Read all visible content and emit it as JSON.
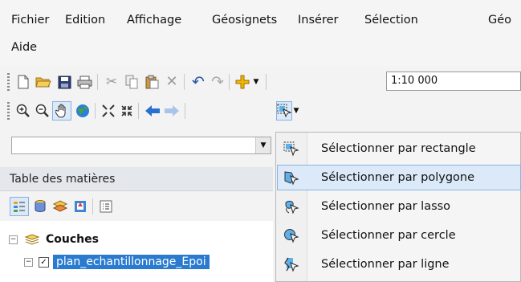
{
  "menu": {
    "row1": [
      "Fichier",
      "Edition",
      "Affichage",
      "Géosignets",
      "Insérer",
      "Sélection",
      "Géo"
    ],
    "row2": [
      "Aide"
    ]
  },
  "standard_toolbar": {
    "scale_value": "1:10 000"
  },
  "toc": {
    "title": "Table des matières",
    "tree": {
      "group_label": "Couches",
      "layer_label": "plan_echantillonnage_Epoi"
    }
  },
  "select_dropdown": {
    "items": [
      {
        "label": "Sélectionner par rectangle",
        "icon": "select-rectangle-icon"
      },
      {
        "label": "Sélectionner par polygone",
        "icon": "select-polygon-icon"
      },
      {
        "label": "Sélectionner par lasso",
        "icon": "select-lasso-icon"
      },
      {
        "label": "Sélectionner par cercle",
        "icon": "select-circle-icon"
      },
      {
        "label": "Sélectionner par ligne",
        "icon": "select-line-icon"
      }
    ],
    "highlighted_item": "Sélectionner par polygone"
  },
  "colors": {
    "highlight": "#dbe9f8",
    "selected_layer": "#2a7bd0"
  }
}
